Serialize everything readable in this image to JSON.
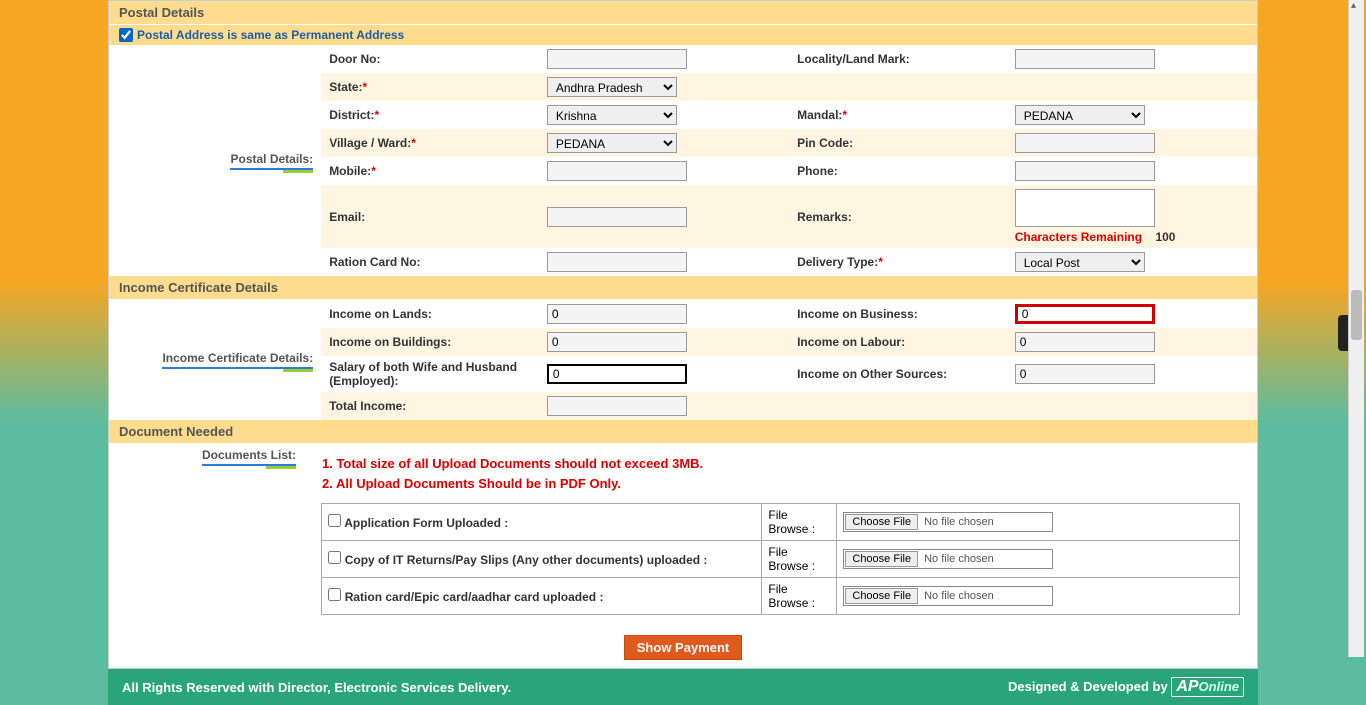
{
  "postal": {
    "section_title": "Postal Details",
    "same_as_label": "Postal Address is same as Permanent Address",
    "same_as_checked": true,
    "side_label": "Postal Details:",
    "door_no_label": "Door No:",
    "door_no": "",
    "locality_label": "Locality/Land Mark:",
    "locality": "",
    "state_label": "State:",
    "state": "Andhra Pradesh",
    "district_label": "District:",
    "district": "Krishna",
    "mandal_label": "Mandal:",
    "mandal": "PEDANA",
    "village_label": "Village / Ward:",
    "village": "PEDANA",
    "pincode_label": "Pin Code:",
    "pincode": "",
    "mobile_label": "Mobile:",
    "mobile": "",
    "phone_label": "Phone:",
    "phone": "",
    "email_label": "Email:",
    "email": "",
    "remarks_label": "Remarks:",
    "remarks": "",
    "chars_remaining_label": "Characters Remaining",
    "chars_remaining_count": "100",
    "ration_label": "Ration Card No:",
    "ration": "",
    "delivery_label": "Delivery Type:",
    "delivery": "Local Post"
  },
  "income": {
    "section_title": "Income Certificate Details",
    "side_label": "Income Certificate Details:",
    "lands_label": "Income on Lands:",
    "lands": "0",
    "business_label": "Income on Business:",
    "business": "0",
    "buildings_label": "Income on Buildings:",
    "buildings": "0",
    "labour_label": "Income on Labour:",
    "labour": "0",
    "salary_label": "Salary of both Wife and Husband (Employed):",
    "salary": "0",
    "other_label": "Income on Other Sources:",
    "other": "0",
    "total_label": "Total Income:",
    "total": ""
  },
  "docs": {
    "section_title": "Document Needed",
    "side_label": "Documents List:",
    "warn1": "1. Total size of all Upload Documents should not exceed 3MB.",
    "warn2": "2. All Upload Documents Should be in PDF Only.",
    "row1_label": "Application Form Uploaded :",
    "row2_label": "Copy of IT Returns/Pay Slips (Any other documents) uploaded :",
    "row3_label": "Ration card/Epic card/aadhar card uploaded :",
    "browse_label": "File Browse :",
    "choose_btn": "Choose File",
    "no_file": "No file chosen"
  },
  "actions": {
    "show_payment": "Show Payment"
  },
  "footer": {
    "left": "All Rights Reserved with Director, Electronic Services Delivery.",
    "right": "Designed & Developed by"
  }
}
